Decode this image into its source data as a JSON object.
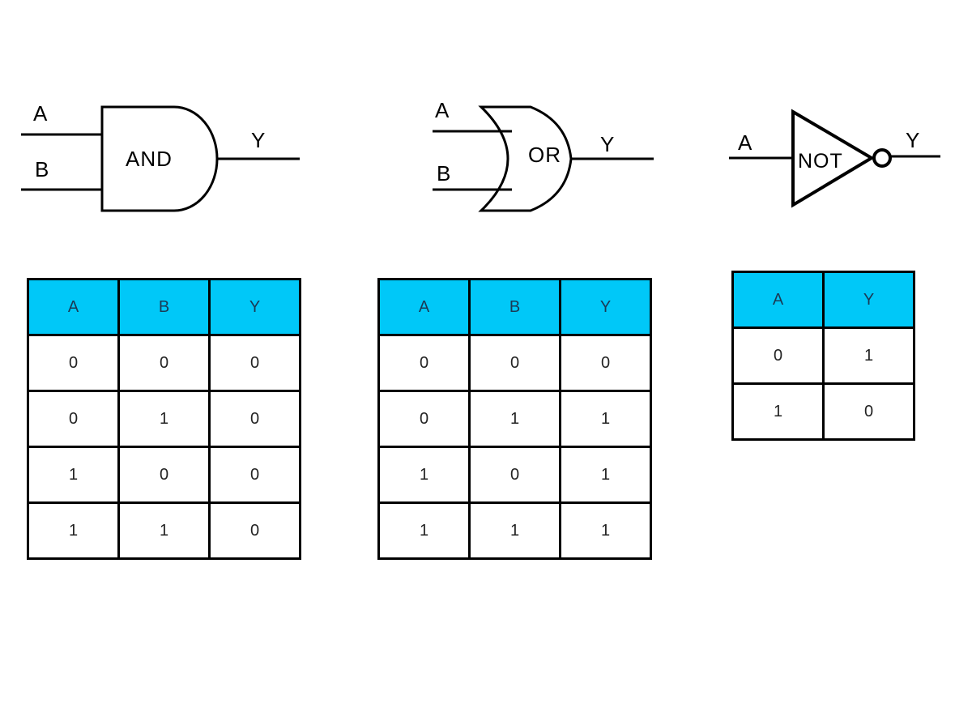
{
  "gates": {
    "and": {
      "label": "AND",
      "inputs": [
        "A",
        "B"
      ],
      "output": "Y"
    },
    "or": {
      "label": "OR",
      "inputs": [
        "A",
        "B"
      ],
      "output": "Y"
    },
    "not": {
      "label": "NOT",
      "inputs": [
        "A"
      ],
      "output": "Y"
    }
  },
  "colors": {
    "header_fill": "#00c8f8",
    "line": "#000000"
  },
  "tables": {
    "and": {
      "headers": [
        "A",
        "B",
        "Y"
      ],
      "rows": [
        [
          "0",
          "0",
          "0"
        ],
        [
          "0",
          "1",
          "0"
        ],
        [
          "1",
          "0",
          "0"
        ],
        [
          "1",
          "1",
          "0"
        ]
      ]
    },
    "or": {
      "headers": [
        "A",
        "B",
        "Y"
      ],
      "rows": [
        [
          "0",
          "0",
          "0"
        ],
        [
          "0",
          "1",
          "1"
        ],
        [
          "1",
          "0",
          "1"
        ],
        [
          "1",
          "1",
          "1"
        ]
      ]
    },
    "not": {
      "headers": [
        "A",
        "Y"
      ],
      "rows": [
        [
          "0",
          "1"
        ],
        [
          "1",
          "0"
        ]
      ]
    }
  }
}
